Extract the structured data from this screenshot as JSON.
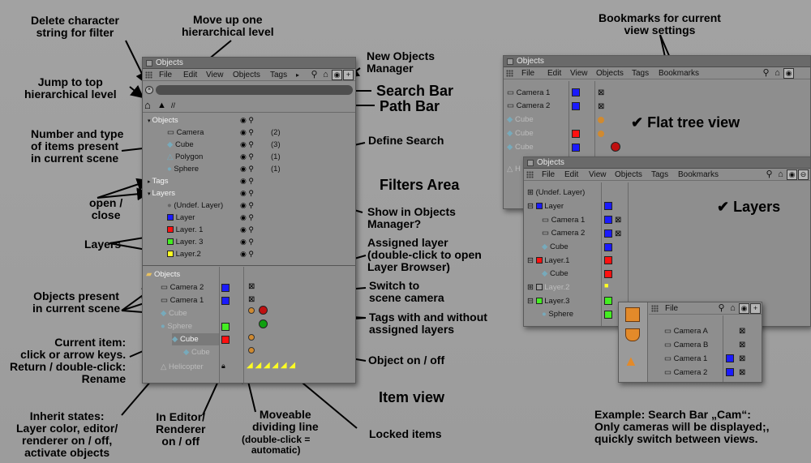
{
  "colors": {
    "layer_blue": "#1a1aff",
    "layer_red": "#ff1010",
    "layer_green": "#44ee22",
    "layer_yellow": "#ffff22",
    "text_dark": "#111111",
    "text_white": "#f4f4f4",
    "panel_bg": "#8e8e8e"
  },
  "annotations": {
    "delete_filter": "Delete character\nstring for filter",
    "move_up": "Move up one\nhierarchical level",
    "new_manager": "New Objects\nManager",
    "jump_top": "Jump to top\nhierarchical level",
    "search_bar": "Search Bar",
    "path_bar": "Path Bar",
    "number_type": "Number and type\nof items present\nin current scene",
    "define_search": "Define Search",
    "filters_area": "Filters Area",
    "open_close": "open /\nclose",
    "show_in_om": "Show in Objects\nManager?",
    "layers": "Layers",
    "assigned_layer": "Assigned layer\n(double-click to open\nLayer Browser)",
    "objects_present": "Objects present\nin current scene",
    "switch_camera": "Switch to\nscene camera",
    "tags_with": "Tags with and without\nassigned layers",
    "current_item": "Current item:\nclick or arrow keys.\nReturn / double-click:\nRename",
    "object_onoff": "Object on / off",
    "item_view": "Item view",
    "inherit": "Inherit states:\nLayer color, editor/\nrenderer on / off,\nactivate objects",
    "in_editor": "In Editor/\nRenderer\non / off",
    "moveable_a": "Moveable\ndividing line",
    "moveable_b": "(double-click =\nautomatic)",
    "locked": "Locked items",
    "bookmarks": "Bookmarks for current\nview settings",
    "flat_tree": "✔ Flat tree view",
    "layers_check": "✔ Layers",
    "example": "Example: Search Bar „Cam“:\nOnly cameras will be displayed;,\nquickly switch between views."
  },
  "main_window": {
    "title": "Objects",
    "menu": [
      "File",
      "Edit",
      "View",
      "Objects",
      "Tags"
    ],
    "path": "//",
    "filters": [
      {
        "label": "Objects",
        "count": ""
      },
      {
        "label": "Camera",
        "count": "(2)"
      },
      {
        "label": "Cube",
        "count": "(3)"
      },
      {
        "label": "Polygon",
        "count": "(1)"
      },
      {
        "label": "Sphere",
        "count": "(1)"
      },
      {
        "label": "Tags",
        "count": ""
      },
      {
        "label": "Layers",
        "count": ""
      },
      {
        "label": "(Undef. Layer)",
        "count": ""
      },
      {
        "label": "Layer",
        "count": ""
      },
      {
        "label": "Layer. 1",
        "count": ""
      },
      {
        "label": "Layer. 3",
        "count": ""
      },
      {
        "label": "Layer.2",
        "count": ""
      }
    ],
    "items": [
      "Objects",
      "Camera 2",
      "Camera 1",
      "Cube",
      "Sphere",
      "Cube",
      "Cube",
      "Helicopter"
    ]
  },
  "flat_window": {
    "title": "Objects",
    "menu": [
      "File",
      "Edit",
      "View",
      "Objects",
      "Tags",
      "Bookmarks"
    ],
    "items": [
      "Camera 1",
      "Camera 2",
      "Cube",
      "Cube",
      "Cube",
      "H"
    ]
  },
  "layers_window": {
    "title": "Objects",
    "menu": [
      "File",
      "Edit",
      "View",
      "Objects",
      "Tags",
      "Bookmarks"
    ],
    "items": [
      "(Undef. Layer)",
      "Layer",
      "Camera 1",
      "Camera 2",
      "Cube",
      "Layer.1",
      "Cube",
      "Layer.2",
      "Layer.3",
      "Sphere"
    ]
  },
  "search_window": {
    "menu": [
      "File"
    ],
    "items": [
      "Camera A",
      "Camera B",
      "Camera 1",
      "Camera 2"
    ]
  }
}
